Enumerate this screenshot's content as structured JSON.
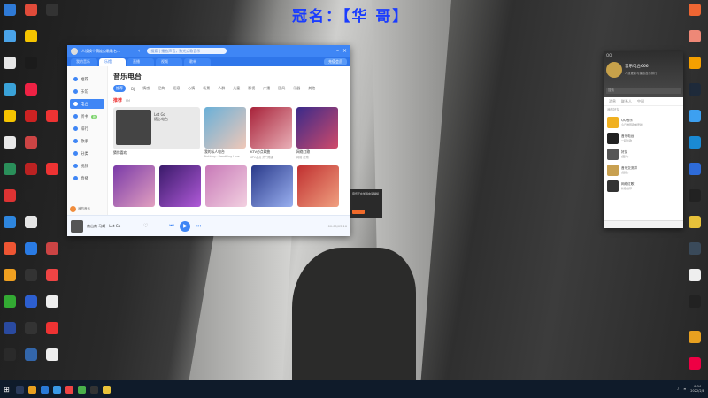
{
  "overlay": {
    "title": "冠名：【华 哥】"
  },
  "music_window": {
    "user": "人设换个萌娃点歌歌名…",
    "search_placeholder": "搜索 | 播放声音，聚光点歌音乐",
    "tabs": [
      {
        "label": "我的音乐",
        "active": false
      },
      {
        "label": "乐馆",
        "active": true
      },
      {
        "label": "直播",
        "active": false
      },
      {
        "label": "视频",
        "active": false
      },
      {
        "label": "歌单",
        "active": false
      }
    ],
    "tab_right": "充值会员",
    "sidebar": [
      {
        "label": "推荐",
        "badge": "",
        "active": false
      },
      {
        "label": "乐馆",
        "badge": "",
        "active": false
      },
      {
        "label": "电台",
        "badge": "",
        "active": true
      },
      {
        "label": "听书",
        "badge": "新",
        "active": false
      },
      {
        "label": "排行",
        "badge": "",
        "active": false
      },
      {
        "label": "歌手",
        "badge": "",
        "active": false
      },
      {
        "label": "分类",
        "badge": "",
        "active": false
      },
      {
        "label": "视频",
        "badge": "",
        "active": false
      },
      {
        "label": "直播",
        "badge": "",
        "active": false
      }
    ],
    "sidebar_user": "我的音乐",
    "page_title": "音乐电台",
    "categories": [
      "推荐",
      "DJ",
      "情感",
      "经典",
      "摇滚",
      "心情",
      "场景",
      "人群",
      "儿童",
      "影视",
      "广播",
      "国风",
      "乐器",
      "其他"
    ],
    "section_title": "推荐",
    "section_sub": "FM",
    "big_card": {
      "title": "Let Go",
      "sub": "随心电台",
      "caption": "猜你喜欢"
    },
    "cards_row1": [
      {
        "t1": "我的私人电台",
        "t2": "Nothing · Breathing Love"
      },
      {
        "t1": "KTV必点歌曲",
        "t2": "KTV必点 热门歌曲"
      },
      {
        "t1": "网络红歌",
        "t2": "网络 红歌"
      }
    ],
    "cards_row2": [
      {
        "t1": "",
        "t2": ""
      },
      {
        "t1": "",
        "t2": ""
      },
      {
        "t1": "",
        "t2": ""
      },
      {
        "t1": "",
        "t2": ""
      },
      {
        "t1": "",
        "t2": ""
      }
    ],
    "player": {
      "song": "南山南 马頔 - Let Go",
      "time": "00:00/03:16"
    }
  },
  "popup": {
    "text": "音乐正在加载中请稍候"
  },
  "qq": {
    "top": "QQ",
    "name": "音乐电台666",
    "signature": "人设更新与播放音乐排行",
    "search": "搜索",
    "tabs": [
      "消息",
      "联系人",
      "空间"
    ],
    "group": "我的好友",
    "rows": [
      {
        "n": "QQ音乐",
        "s": "今日推荐歌单更新"
      },
      {
        "n": "音乐电台",
        "s": "一起听歌"
      },
      {
        "n": "好友",
        "s": "[图片]"
      },
      {
        "n": "音乐交流群",
        "s": "[链接]"
      },
      {
        "n": "网络红歌",
        "s": "新歌推荐"
      }
    ]
  },
  "taskbar": {
    "clock_time": "9:04",
    "clock_date": "2022/2/8"
  }
}
